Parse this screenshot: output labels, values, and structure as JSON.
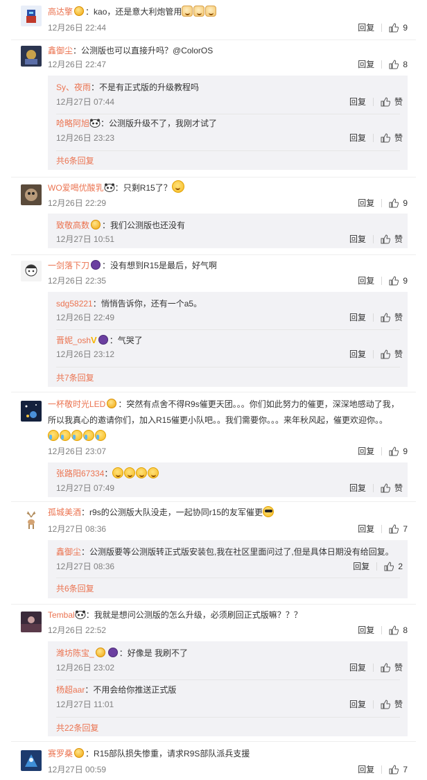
{
  "labels": {
    "reply": "回复",
    "like_zan": "赞"
  },
  "comments": [
    {
      "user": "高达擎",
      "text": "kao，还是意大利炮管用",
      "time": "12月26日 22:44",
      "likes": "9",
      "emojis": [
        "doge",
        "doge",
        "doge"
      ]
    },
    {
      "user": "鑫御尘",
      "text": "公测版也可以直接升吗？@ColorOS",
      "time": "12月26日 22:47",
      "likes": "8",
      "replies": [
        {
          "user": "Sy、夜雨",
          "text": "不是有正式版的升级教程吗",
          "time": "12月27日 07:44",
          "likes": "赞"
        },
        {
          "user": "哈略阿旭",
          "text": "公测版升级不了，我刚才试了",
          "time": "12月26日 23:23",
          "likes": "赞"
        }
      ],
      "more": "共6条回复"
    },
    {
      "user": "WO爱喝优酸乳",
      "text": "只剩R15了？",
      "time": "12月26日 22:29",
      "likes": "9",
      "replies": [
        {
          "user": "致敬高数",
          "text": "我们公测版也还没有",
          "time": "12月27日 10:51",
          "likes": "赞"
        }
      ]
    },
    {
      "user": "一剑落下刀",
      "text": "没有想到R15是最后，好气啊",
      "time": "12月26日 22:35",
      "likes": "9",
      "replies": [
        {
          "user": "sdg58221",
          "text": "悄悄告诉你，还有一个a5。",
          "time": "12月26日 22:49",
          "likes": "赞"
        },
        {
          "user": "晋妮_osh",
          "text": "气哭了",
          "time": "12月26日 23:12",
          "likes": "赞"
        }
      ],
      "more": "共7条回复"
    },
    {
      "user": "一杯敬时光LED",
      "text": "突然有点舍不得R9s催更天团。。。你们如此努力的催更，深深地感动了我，",
      "text2": "所以我真心的邀请你们，加入R15催更小队吧。。我们需要你。。。来年秋风起，催更欢迎你。。",
      "time": "12月26日 23:07",
      "likes": "9",
      "replies": [
        {
          "user": "张路阳67334",
          "text": "",
          "time": "12月27日 07:49",
          "likes": "赞"
        }
      ]
    },
    {
      "user": "孤城美酒",
      "text": "r9s的公测版大队没走，一起协同r15的友军催更",
      "time": "12月27日 08:36",
      "likes": "7",
      "replies": [
        {
          "user": "鑫御尘",
          "text": "公测版要等公测版转正式版安装包,我在社区里面问过了,但是具体日期没有给回复。",
          "time": "12月27日 08:36",
          "likes": "2"
        }
      ],
      "more": "共6条回复"
    },
    {
      "user": "Tembal",
      "text": "我就是想问公测版的怎么升级，必须刷回正式版嘛？？？",
      "time": "12月26日 22:52",
      "likes": "8",
      "replies": [
        {
          "user": "潍坊陈宝_",
          "text": "好像是 我刷不了",
          "time": "12月26日 23:02",
          "likes": "赞"
        },
        {
          "user": "杨超aar",
          "text": "不用会给你推送正式版",
          "time": "12月27日 11:01",
          "likes": "赞"
        }
      ],
      "more": "共22条回复"
    },
    {
      "user": "赛罗桑",
      "text": "R15部队损失惨重，请求R9S部队派兵支援",
      "time": "12月27日 00:59",
      "likes": "7"
    }
  ],
  "colors": {
    "username": "#eb7350",
    "subbox_bg": "#f2f2f5",
    "time": "#808080"
  }
}
